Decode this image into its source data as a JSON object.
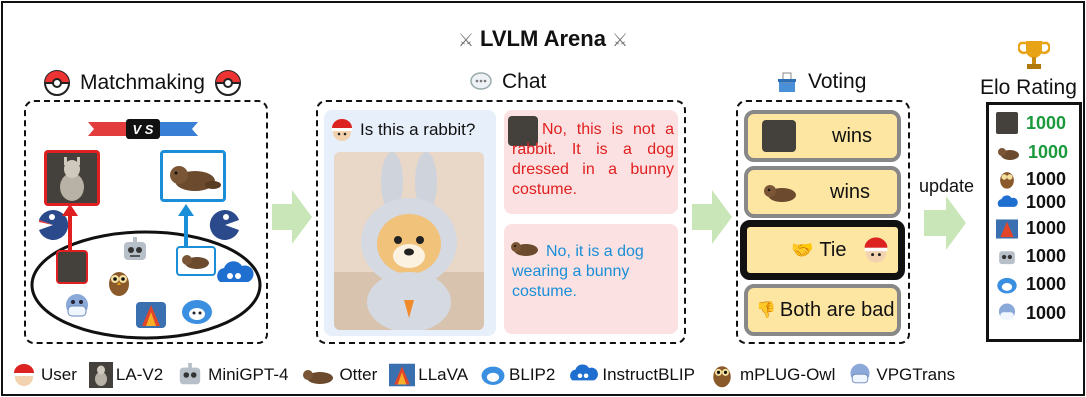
{
  "title": "LVLM Arena",
  "sections": {
    "matchmaking": "Matchmaking",
    "chat": "Chat",
    "voting": "Voting",
    "elo": "Elo Rating"
  },
  "vs_label": "V S",
  "chat": {
    "user_question": "Is this a rabbit?",
    "model_a_reply": "No, this is not a rabbit. It is a dog dressed in a bunny costume.",
    "model_b_reply": "No, it is a dog wearing a bunny costume."
  },
  "voting": {
    "option_a": "wins",
    "option_b": "wins",
    "tie": "Tie",
    "both_bad": "Both are bad"
  },
  "update_label": "update",
  "elo_ratings": [
    "1000",
    "1000",
    "1000",
    "1000",
    "1000",
    "1000",
    "1000",
    "1000"
  ],
  "elo_colors": [
    "#1a9a3c",
    "#1a9a3c",
    "#111111",
    "#111111",
    "#111111",
    "#111111",
    "#111111",
    "#111111"
  ],
  "legend": [
    "User",
    "LA-V2",
    "MiniGPT-4",
    "Otter",
    "LLaVA",
    "BLIP2",
    "InstructBLIP",
    "mPLUG-Owl",
    "VPGTrans"
  ],
  "colors": {
    "model_a": "#e02020",
    "model_b": "#1a8fd8",
    "arrow_green": "#c9e6b8",
    "chat_user_bg": "#e6effa",
    "chat_reply_bg": "#fbe1e1",
    "vote_bg": "#fde6a2"
  }
}
